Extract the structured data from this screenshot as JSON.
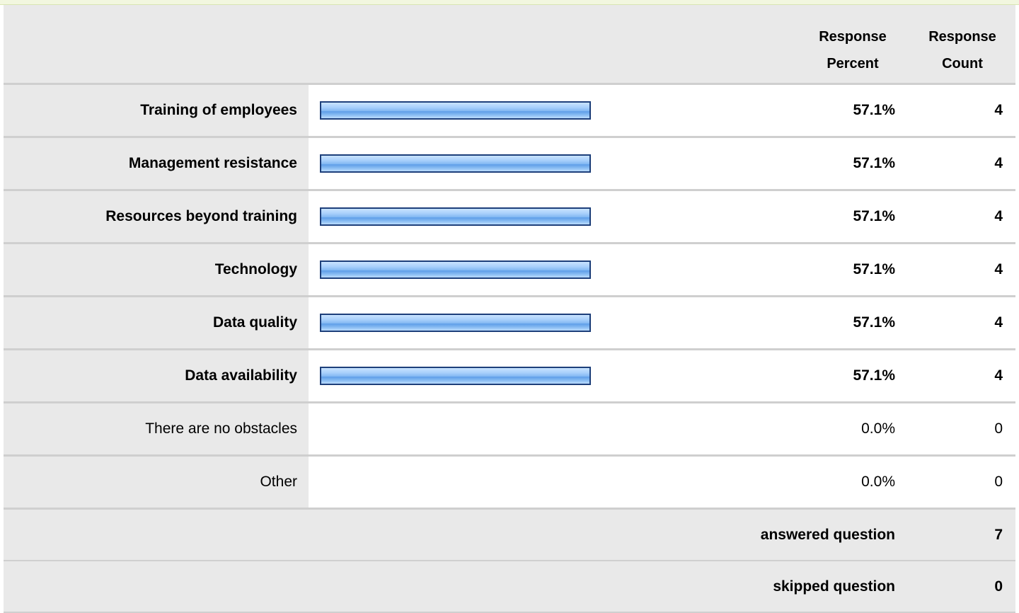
{
  "header": {
    "percent_line1": "Response",
    "percent_line2": "Percent",
    "count_line1": "Response",
    "count_line2": "Count"
  },
  "rows": [
    {
      "label": "Training of employees",
      "percent": "57.1%",
      "count": "4",
      "fraction": 0.571
    },
    {
      "label": "Management resistance",
      "percent": "57.1%",
      "count": "4",
      "fraction": 0.571
    },
    {
      "label": "Resources beyond training",
      "percent": "57.1%",
      "count": "4",
      "fraction": 0.571
    },
    {
      "label": "Technology",
      "percent": "57.1%",
      "count": "4",
      "fraction": 0.571
    },
    {
      "label": "Data quality",
      "percent": "57.1%",
      "count": "4",
      "fraction": 0.571
    },
    {
      "label": "Data availability",
      "percent": "57.1%",
      "count": "4",
      "fraction": 0.571
    },
    {
      "label": "There are no obstacles",
      "percent": "0.0%",
      "count": "0",
      "fraction": 0
    },
    {
      "label": "Other",
      "percent": "0.0%",
      "count": "0",
      "fraction": 0
    }
  ],
  "footer": {
    "answered_label": "answered question",
    "answered_value": "7",
    "skipped_label": "skipped question",
    "skipped_value": "0"
  },
  "colors": {
    "bar_border": "#1d3f7a",
    "bar_fill": "#7fb6f2",
    "label_bg": "#e9e9e9"
  }
}
